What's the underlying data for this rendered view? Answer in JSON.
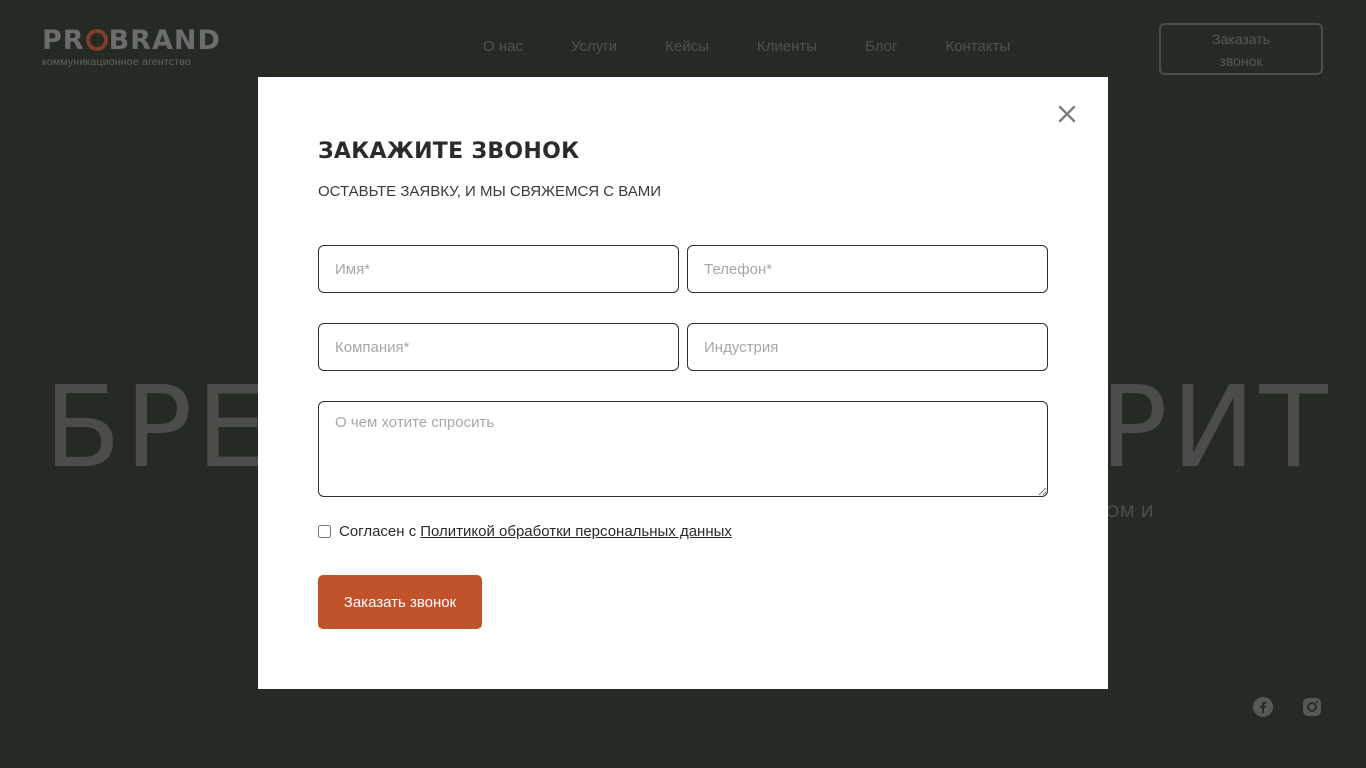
{
  "header": {
    "logo_text_before": "PR",
    "logo_text_after": "BRAND",
    "logo_subtitle": "коммуникационное агентство",
    "nav": [
      "О нас",
      "Услуги",
      "Кейсы",
      "Клиенты",
      "Блог",
      "Контакты"
    ],
    "cta_label": "Заказать звонок"
  },
  "hero": {
    "left_text": "БРЕ",
    "right_text": "РИТ",
    "sub_fragment": "ОМ И"
  },
  "social": {
    "icons": [
      "facebook-icon",
      "instagram-icon"
    ]
  },
  "modal": {
    "title": "ЗАКАЖИТЕ ЗВОНОК",
    "subtitle": "ОСТАВЬТЕ ЗАЯВКУ, И МЫ СВЯЖЕМСЯ С ВАМИ",
    "fields": {
      "name_placeholder": "Имя*",
      "phone_placeholder": "Телефон*",
      "company_placeholder": "Компания*",
      "industry_placeholder": "Индустрия",
      "question_placeholder": "О чем хотите спросить"
    },
    "consent_text": "Согласен с",
    "consent_link": "Политикой обработки персональных данных",
    "submit_label": "Заказать звонок"
  },
  "colors": {
    "background": "#2e352c",
    "accent": "#c0532c",
    "modal_bg": "#ffffff"
  }
}
